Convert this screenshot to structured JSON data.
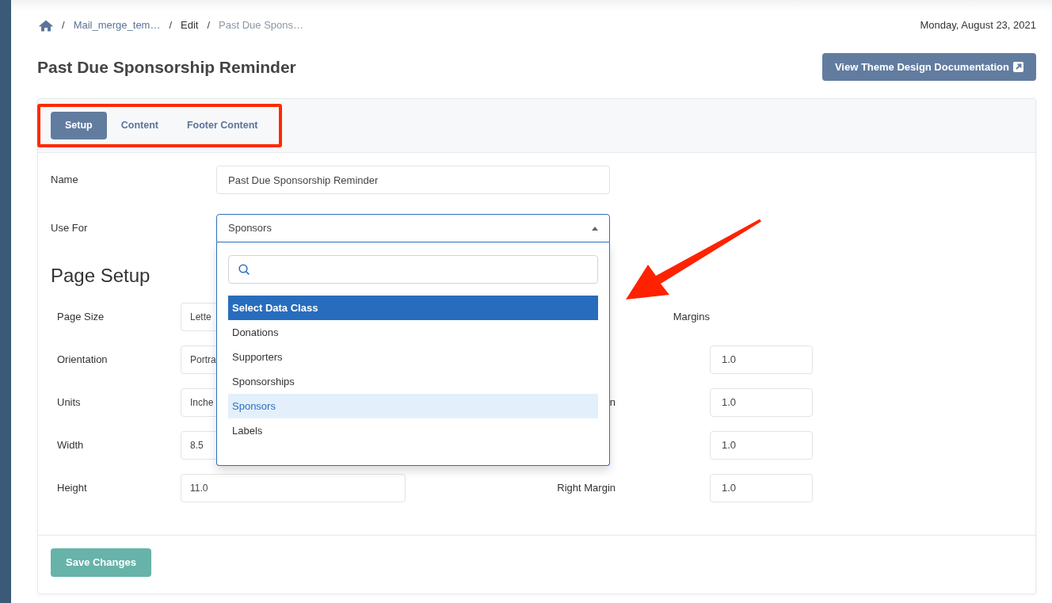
{
  "breadcrumb": [
    {
      "kind": "home"
    },
    {
      "kind": "separator",
      "label": "/"
    },
    {
      "kind": "link",
      "label": "Mail_merge_tem…"
    },
    {
      "kind": "separator",
      "label": "/"
    },
    {
      "kind": "text",
      "label": "Edit"
    },
    {
      "kind": "separator",
      "label": "/"
    },
    {
      "kind": "current",
      "label": "Past Due Spons…"
    }
  ],
  "date": "Monday, August 23, 2021",
  "title": "Past Due Sponsorship Reminder",
  "doc_button": {
    "label": "View Theme Design Documentation"
  },
  "tab_bar": {
    "annotation_frame": true,
    "tabs": [
      {
        "label": "Setup",
        "selected": true
      },
      {
        "label": "Content",
        "selected": false
      },
      {
        "label": "Footer Content",
        "selected": false
      }
    ]
  },
  "form": {
    "name": {
      "label": "Name",
      "value": "Past Due Sponsorship Reminder"
    },
    "use_for": {
      "label": "Use For",
      "value": "Sponsors",
      "expanded": true,
      "annotation_arrow": true,
      "options": [
        {
          "label": "Select Data Class",
          "highlighted": true,
          "selected": false
        },
        {
          "label": "Donations",
          "highlighted": false,
          "selected": false
        },
        {
          "label": "Supporters",
          "highlighted": false,
          "selected": false
        },
        {
          "label": "Sponsorships",
          "highlighted": false,
          "selected": false
        },
        {
          "label": "Sponsors",
          "highlighted": false,
          "selected": true
        },
        {
          "label": "Labels",
          "highlighted": false,
          "selected": false
        }
      ]
    }
  },
  "page_setup": {
    "heading": "Page Setup",
    "fields": [
      {
        "label": "Page Size",
        "value": "Lette"
      },
      {
        "label": "Orientation",
        "value": "Portra"
      },
      {
        "label": "Units",
        "value": "Inche"
      },
      {
        "label": "Width",
        "value": "8.5"
      },
      {
        "label": "Height",
        "value": "11.0"
      }
    ],
    "margins_heading": "Margins",
    "margins": [
      {
        "value": "1.0"
      },
      {
        "label": "n",
        "value": "1.0"
      },
      {
        "value": "1.0"
      },
      {
        "label": "Right Margin",
        "value": "1.0"
      }
    ]
  },
  "save_button": {
    "label": "Save Changes"
  }
}
